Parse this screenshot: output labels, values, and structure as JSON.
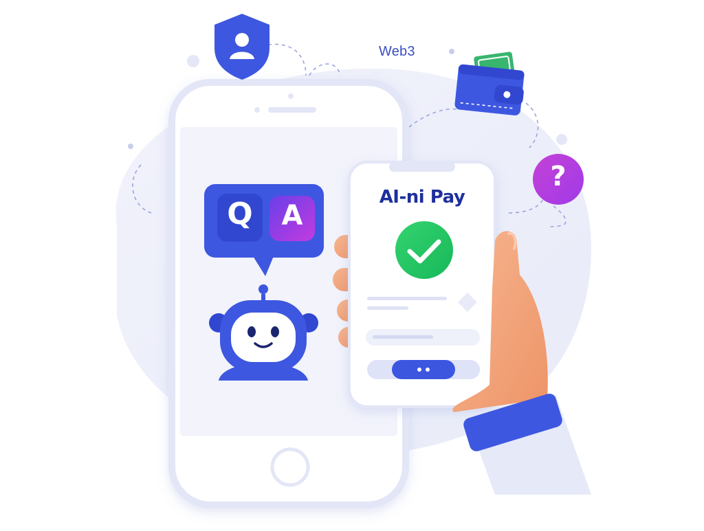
{
  "labels": {
    "web3": "Web3",
    "pay_title": "AI-ni Pay",
    "qa_q": "Q",
    "qa_a": "A",
    "question_mark": "?"
  },
  "icons": [
    "shield-user-icon",
    "wallet-icon",
    "question-mark-icon",
    "chat-bubble-icon",
    "robot-icon",
    "checkmark-icon",
    "hand-icon"
  ],
  "colors": {
    "primary_blue": "#3e57e0",
    "dark_blue": "#1f2f9c",
    "purple_accent": "#a536e0",
    "success_green": "#22c55e",
    "question_pink": "#c73fd0",
    "phone_outline": "#e6e9f8",
    "background_blob": "#eef0fa",
    "skin": "#f5a37b"
  }
}
